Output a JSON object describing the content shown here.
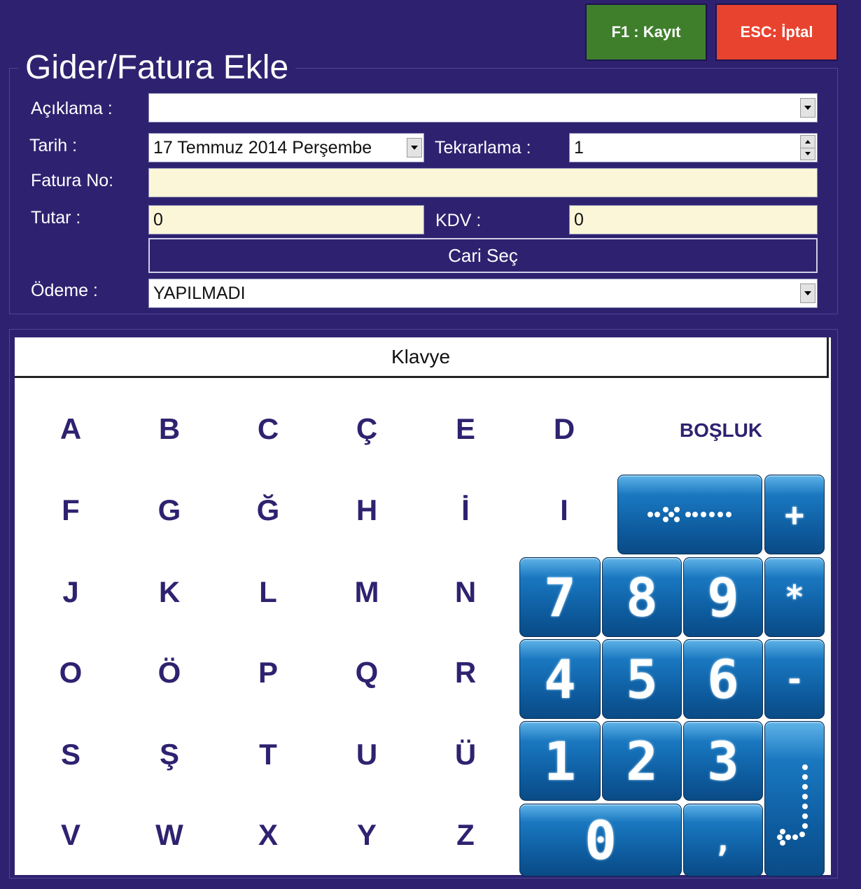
{
  "header": {
    "title": "Gider/Fatura Ekle",
    "save_label": "F1 : Kayıt",
    "cancel_label": "ESC: İptal"
  },
  "form": {
    "aciklama_label": "Açıklama :",
    "aciklama_value": "",
    "tarih_label": "Tarih :",
    "tarih_value": "17 Temmuz 2014 Perşembe",
    "tekrarlama_label": "Tekrarlama :",
    "tekrarlama_value": "1",
    "fatura_no_label": "Fatura No:",
    "fatura_no_value": "",
    "tutar_label": "Tutar :",
    "tutar_value": "0",
    "kdv_label": "KDV :",
    "kdv_value": "0",
    "cari_sec_label": "Cari Seç",
    "odeme_label": "Ödeme :",
    "odeme_value": "YAPILMADI"
  },
  "keyboard": {
    "title": "Klavye",
    "rows": [
      [
        "A",
        "B",
        "C",
        "Ç",
        "E",
        "D"
      ],
      [
        "F",
        "G",
        "Ğ",
        "H",
        "İ",
        "I"
      ],
      [
        "J",
        "K",
        "L",
        "M",
        "N"
      ],
      [
        "O",
        "Ö",
        "P",
        "Q",
        "R"
      ],
      [
        "S",
        "Ş",
        "T",
        "U",
        "Ü"
      ],
      [
        "V",
        "W",
        "X",
        "Y",
        "Z"
      ]
    ],
    "space_label": "BOŞLUK"
  },
  "numpad": {
    "digits": [
      "7",
      "8",
      "9",
      "4",
      "5",
      "6",
      "1",
      "2",
      "3",
      "0"
    ],
    "plus": "+",
    "multiply": "*",
    "minus": "-",
    "comma": ","
  },
  "colors": {
    "background": "#2e2270",
    "save_button": "#3f7f2c",
    "cancel_button": "#e8432f",
    "input_cream": "#fbf6d8",
    "keyboard_text": "#2e2270",
    "numpad_blue": "#0d5b9e"
  },
  "icons": {
    "backspace": "backspace-icon",
    "enter": "enter-icon"
  }
}
